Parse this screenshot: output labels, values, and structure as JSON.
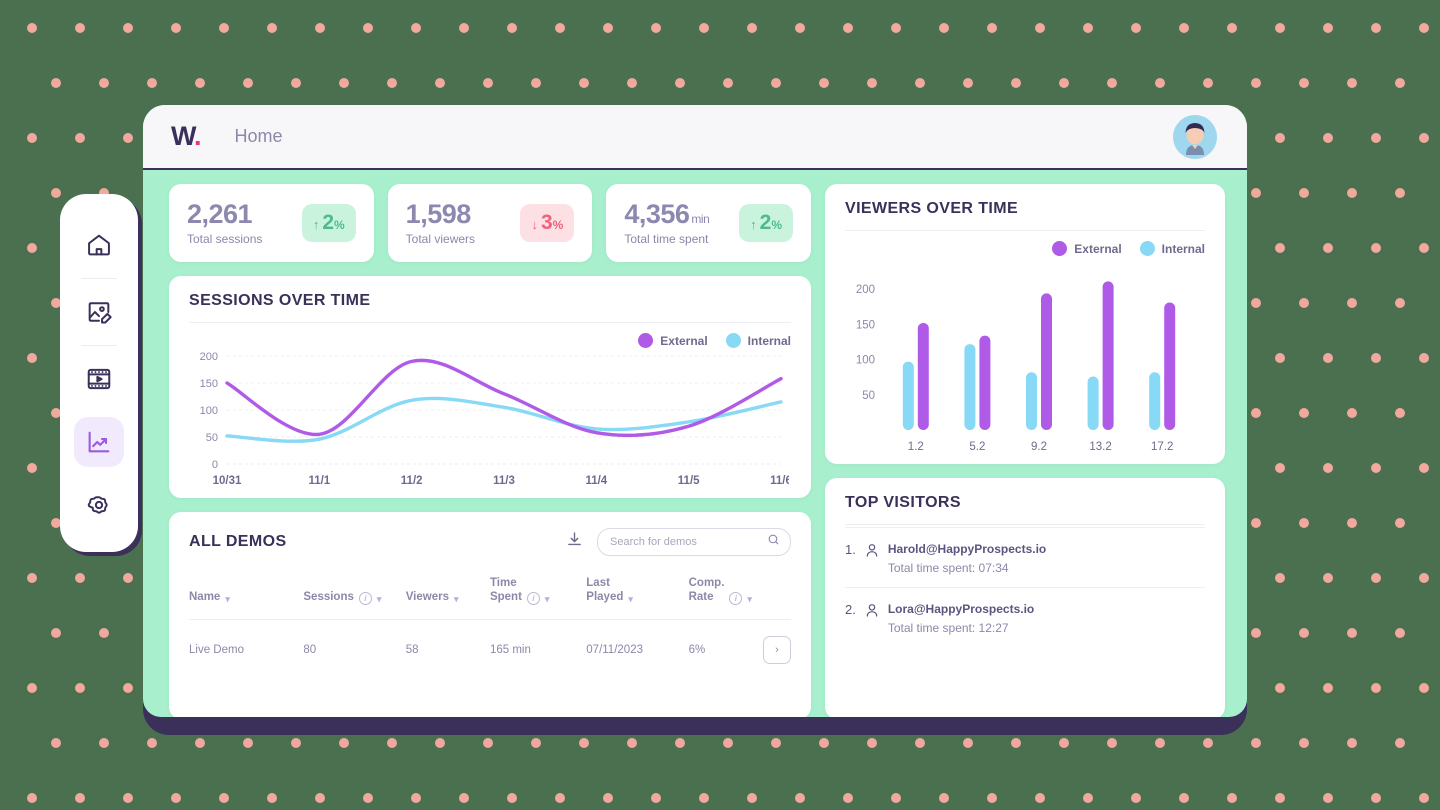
{
  "app": {
    "logo_text": "W",
    "logo_dot": ".",
    "nav_current": "Home"
  },
  "colors": {
    "background": "#4a7050",
    "dots": "#f0a99c",
    "frame": "#3a3059",
    "panel_mint": "#a8f0cd",
    "external": "#b05ae8",
    "internal": "#87d9f5",
    "accent_pink": "#ef2f85",
    "badge_up_bg": "#caf3dd",
    "badge_up_text": "#4fba8e",
    "badge_down_bg": "#fde0e4",
    "badge_down_text": "#f2617c",
    "title": "#3a3059",
    "muted": "#8c88a8"
  },
  "sidebar": {
    "items": [
      {
        "name": "home",
        "icon": "home-icon",
        "active": false
      },
      {
        "name": "media",
        "icon": "image-edit-icon",
        "active": false
      },
      {
        "name": "video",
        "icon": "video-icon",
        "active": false
      },
      {
        "name": "analytics",
        "icon": "analytics-icon",
        "active": true
      },
      {
        "name": "settings",
        "icon": "gear-icon",
        "active": false
      }
    ]
  },
  "stats": [
    {
      "value": "2,261",
      "unit": "",
      "label": "Total sessions",
      "delta": "2",
      "delta_pct": "%",
      "direction": "up",
      "arrow": "↑"
    },
    {
      "value": "1,598",
      "unit": "",
      "label": "Total viewers",
      "delta": "3",
      "delta_pct": "%",
      "direction": "down",
      "arrow": "↓"
    },
    {
      "value": "4,356",
      "unit": "min",
      "label": "Total time spent",
      "delta": "2",
      "delta_pct": "%",
      "direction": "up",
      "arrow": "↑"
    }
  ],
  "sessions_card": {
    "title": "SESSIONS OVER TIME",
    "legend": [
      {
        "label": "External",
        "color": "#b05ae8"
      },
      {
        "label": "Internal",
        "color": "#87d9f5"
      }
    ]
  },
  "viewers_card": {
    "title": "VIEWERS OVER TIME",
    "legend": [
      {
        "label": "External",
        "color": "#b05ae8"
      },
      {
        "label": "Internal",
        "color": "#87d9f5"
      }
    ]
  },
  "demos_card": {
    "title": "ALL DEMOS",
    "download_icon": "download-icon",
    "search": {
      "placeholder": "Search for demos",
      "value": "",
      "icon": "search-icon"
    },
    "columns": [
      {
        "label": "Name",
        "info": false,
        "sort": true
      },
      {
        "label": "Sessions",
        "info": true,
        "sort": true
      },
      {
        "label": "Viewers",
        "info": false,
        "sort": true
      },
      {
        "label": "Time\nSpent",
        "info": true,
        "sort": true
      },
      {
        "label": "Last\nPlayed",
        "info": false,
        "sort": true
      },
      {
        "label": "Comp.\nRate",
        "info": true,
        "sort": true
      }
    ],
    "rows": [
      {
        "name": "Live Demo",
        "sessions": "80",
        "viewers": "58",
        "time_spent": "165 min",
        "last_played": "07/11/2023",
        "comp_rate": "6%",
        "action": "›"
      }
    ]
  },
  "visitors_card": {
    "title": "TOP VISITORS",
    "items": [
      {
        "rank": "1.",
        "email": "Harold@HappyProspects.io",
        "time_label": "Total time spent: 07:34"
      },
      {
        "rank": "2.",
        "email": "Lora@HappyProspects.io",
        "time_label": "Total time spent: 12:27"
      }
    ]
  },
  "chart_data": [
    {
      "type": "line",
      "title": "SESSIONS OVER TIME",
      "xlabel": "",
      "ylabel": "",
      "categories": [
        "10/31",
        "11/1",
        "11/2",
        "11/3",
        "11/4",
        "11/5",
        "11/6"
      ],
      "yticks": [
        0,
        50,
        100,
        150,
        200
      ],
      "ylim": [
        0,
        200
      ],
      "grid": true,
      "legend_position": "top-right",
      "series": [
        {
          "name": "External",
          "color": "#b05ae8",
          "values": [
            150,
            55,
            190,
            130,
            58,
            70,
            158
          ]
        },
        {
          "name": "Internal",
          "color": "#87d9f5",
          "values": [
            52,
            46,
            118,
            105,
            65,
            78,
            115
          ]
        }
      ]
    },
    {
      "type": "bar",
      "title": "VIEWERS OVER TIME",
      "xlabel": "",
      "ylabel": "",
      "categories": [
        "1.2",
        "5.2",
        "9.2",
        "13.2",
        "17.2"
      ],
      "yticks": [
        50,
        100,
        150,
        200
      ],
      "ylim": [
        0,
        230
      ],
      "grid": false,
      "legend_position": "top-right",
      "series": [
        {
          "name": "Internal",
          "color": "#87d9f5",
          "values": [
            97,
            122,
            82,
            76,
            82
          ]
        },
        {
          "name": "External",
          "color": "#b05ae8",
          "values": [
            152,
            134,
            194,
            211,
            181
          ]
        }
      ]
    }
  ]
}
